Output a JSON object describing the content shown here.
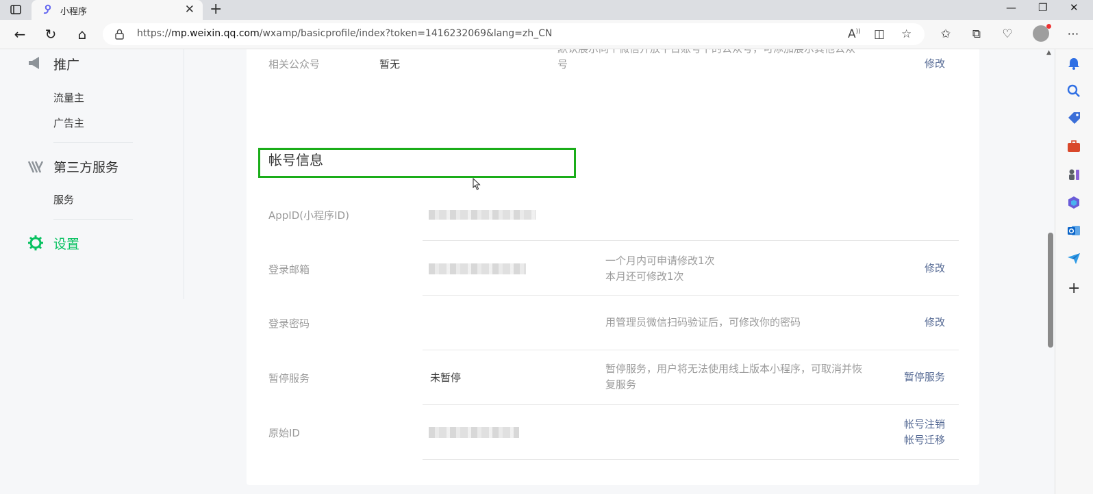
{
  "browser": {
    "tab_title": "小程序",
    "new_tab": "+",
    "url_prefix": "https://",
    "url_host": "mp.weixin.qq.com",
    "url_path": "/wxamp/basicprofile/index?token=1416232069&lang=zh_CN"
  },
  "sidebar": {
    "promo_title": "推广",
    "promo_items": [
      "流量主",
      "广告主"
    ],
    "third_party_title": "第三方服务",
    "third_party_items": [
      "服务"
    ],
    "settings_title": "设置"
  },
  "top_card": {
    "label": "相关公众号",
    "value": "暂无",
    "desc_1": "默认展示同个微信开放平台账号下的公众号，可添加展示其他公众",
    "desc_2": "号",
    "action": "修改"
  },
  "account": {
    "title": "帐号信息",
    "rows": [
      {
        "label": "AppID(小程序ID)",
        "value": "",
        "desc": "",
        "action": ""
      },
      {
        "label": "登录邮箱",
        "value": "",
        "desc_1": "一个月内可申请修改1次",
        "desc_2": "本月还可修改1次",
        "action": "修改"
      },
      {
        "label": "登录密码",
        "value": "",
        "desc_1": "用管理员微信扫码验证后，可修改你的密码",
        "desc_2": "",
        "action": "修改"
      },
      {
        "label": "暂停服务",
        "value": "未暂停",
        "desc_1": "暂停服务，用户将无法使用线上版本小程序，可取消并恢",
        "desc_2": "复服务",
        "action": "暂停服务"
      },
      {
        "label": "原始ID",
        "value": "",
        "desc_1": "",
        "desc_2": "",
        "action": "帐号注销",
        "action_2": "帐号迁移"
      }
    ]
  },
  "colors": {
    "accent_green": "#07c160",
    "link_blue": "#576b95",
    "highlight": "#1aad19"
  }
}
